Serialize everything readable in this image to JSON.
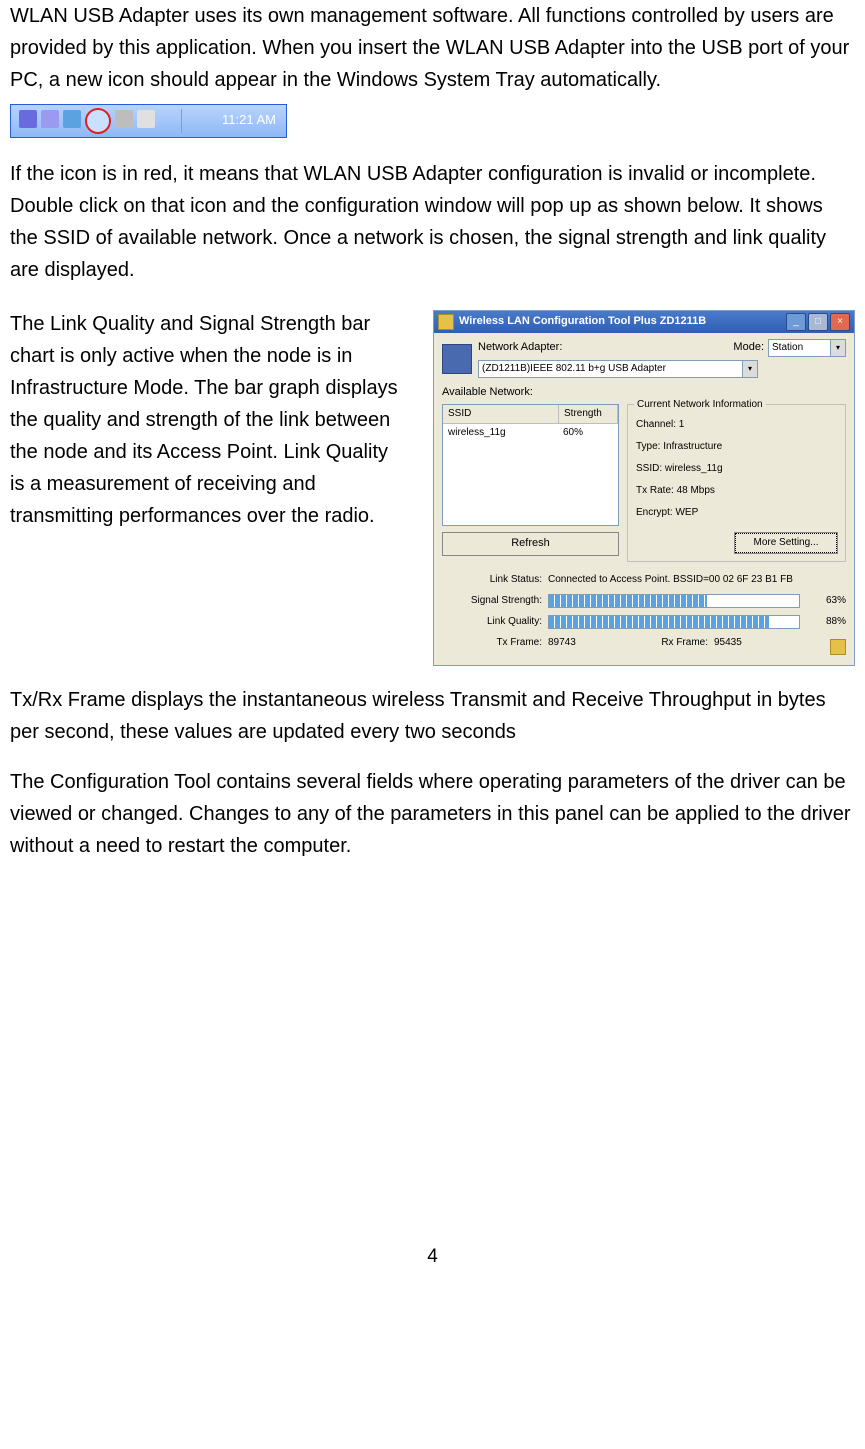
{
  "para1": "WLAN USB Adapter uses its own management software. All functions controlled by users are provided by this application. When you insert the WLAN USB Adapter into the USB port of your PC, a new icon should appear in the Windows System Tray automatically.",
  "tray_time": "11:21 AM",
  "para2": "If the icon is in red, it means that WLAN USB Adapter configuration is invalid or incomplete. Double click on that icon and the configuration window will pop up as shown below. It shows the SSID of available network. Once a network is chosen, the signal strength and link quality are displayed.",
  "para3": "The Link Quality and Signal Strength bar chart is only active when the node is in Infrastructure Mode. The bar graph displays the quality and strength of the link between the node and its Access Point. Link Quality is a measurement of receiving and transmitting performances over the radio.",
  "para4": "Tx/Rx Frame displays the instantaneous wireless Transmit and Receive Throughput in bytes per second, these values are updated every two seconds",
  "para5": "The Configuration Tool contains several fields where operating parameters of the driver can be viewed or changed. Changes to any of the parameters in this panel can be applied to the driver without a need to restart the computer.",
  "page_number": "4",
  "cfg": {
    "title": "Wireless LAN Configuration Tool Plus   ZD1211B",
    "na_label": "Network Adapter:",
    "mode_label": "Mode:",
    "mode_value": "Station",
    "adapter_value": "(ZD1211B)IEEE 802.11 b+g USB Adapter",
    "avail_label": "Available Network:",
    "table": {
      "h1": "SSID",
      "h2": "Strength",
      "r1c1": "wireless_11g",
      "r1c2": "60%"
    },
    "refresh_label": "Refresh",
    "info_group_title": "Current Network Information",
    "info": {
      "channel": "Channel: 1",
      "type": "Type: Infrastructure",
      "ssid": "SSID: wireless_11g",
      "txrate": "Tx Rate: 48 Mbps",
      "encrypt": "Encrypt: WEP"
    },
    "more_label": "More Setting...",
    "status": {
      "link_label": "Link Status:",
      "link_value": "Connected to Access Point. BSSID=00 02 6F 23 B1 FB",
      "sig_label": "Signal Strength:",
      "sig_pct": "63%",
      "lq_label": "Link Quality:",
      "lq_pct": "88%",
      "txf_label": "Tx Frame:",
      "txf_val": "89743",
      "rxf_label": "Rx Frame:",
      "rxf_val": "95435"
    }
  }
}
